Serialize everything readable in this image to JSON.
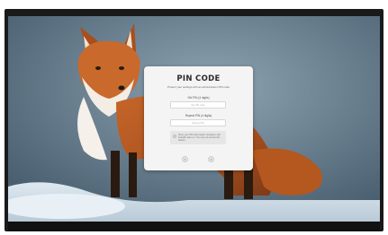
{
  "dialog": {
    "title": "PIN CODE",
    "subtitle": "Protect your settings with an administrator PIN code",
    "set_pin_label": "Set PIN (4 digits)",
    "set_pin_placeholder": "Set PIN code",
    "repeat_pin_label": "Repeat PIN (4 digits)",
    "repeat_pin_placeholder": "Repeat PIN",
    "note": "Store your PIN code safely. Settings is still lockable later on. You may not access this feature.",
    "back_icon": "chevron-left-icon",
    "next_icon": "chevron-right-icon",
    "back_glyph": "‹",
    "next_glyph": "›"
  },
  "colors": {
    "dialog_bg": "#f4f4f4",
    "title": "#2a2a2a",
    "frame": "#1a1a1a"
  }
}
